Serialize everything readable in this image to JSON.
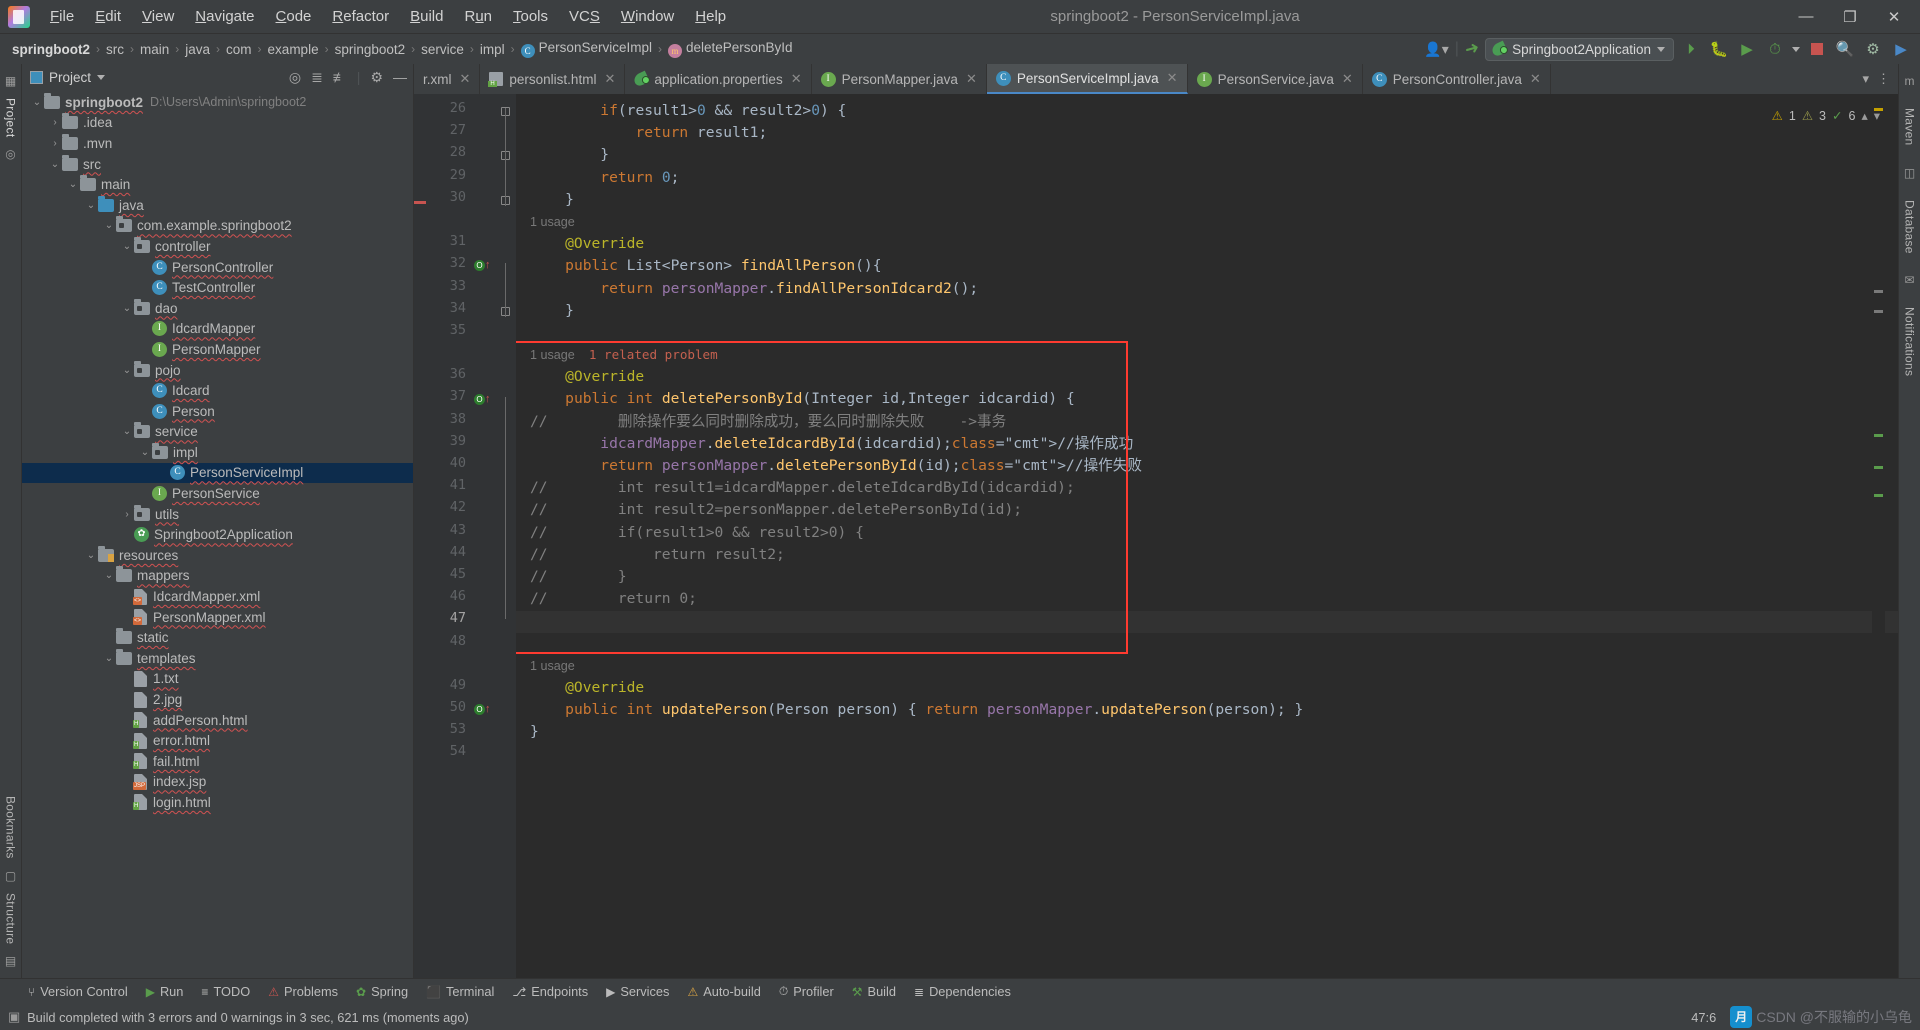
{
  "window": {
    "title": "springboot2 - PersonServiceImpl.java",
    "minimize": "—",
    "maximize": "❐",
    "close": "✕"
  },
  "menu": [
    "File",
    "Edit",
    "View",
    "Navigate",
    "Code",
    "Refactor",
    "Build",
    "Run",
    "Tools",
    "VCS",
    "Window",
    "Help"
  ],
  "breadcrumb": [
    {
      "label": "springboot2",
      "icon": ""
    },
    {
      "label": "src",
      "icon": ""
    },
    {
      "label": "main",
      "icon": ""
    },
    {
      "label": "java",
      "icon": ""
    },
    {
      "label": "com",
      "icon": ""
    },
    {
      "label": "example",
      "icon": ""
    },
    {
      "label": "springboot2",
      "icon": ""
    },
    {
      "label": "service",
      "icon": ""
    },
    {
      "label": "impl",
      "icon": ""
    },
    {
      "label": "PersonServiceImpl",
      "icon": "class-icon"
    },
    {
      "label": "deletePersonById",
      "icon": "method-icon"
    }
  ],
  "toolbar": {
    "run_config": "Springboot2Application",
    "icons": [
      "run-icon",
      "debug-icon",
      "run-with-coverage-icon",
      "profiler-icon",
      "stop-icon",
      "search-icon",
      "settings-icon",
      "ide-icon"
    ]
  },
  "project_panel": {
    "title": "Project",
    "tools": [
      "locate-icon",
      "expand-all-icon",
      "collapse-all-icon",
      "settings-icon",
      "hide-icon"
    ],
    "tree": [
      {
        "depth": 0,
        "arrow": "⌄",
        "icon": "module",
        "label": "springboot2",
        "bold": true,
        "path": "D:\\Users\\Admin\\springboot2"
      },
      {
        "depth": 1,
        "arrow": "›",
        "icon": "folder",
        "label": ".idea"
      },
      {
        "depth": 1,
        "arrow": "›",
        "icon": "folder",
        "label": ".mvn"
      },
      {
        "depth": 1,
        "arrow": "⌄",
        "icon": "folder",
        "label": "src"
      },
      {
        "depth": 2,
        "arrow": "⌄",
        "icon": "folder",
        "label": "main"
      },
      {
        "depth": 3,
        "arrow": "⌄",
        "icon": "folder-blue",
        "label": "java"
      },
      {
        "depth": 4,
        "arrow": "⌄",
        "icon": "package",
        "label": "com.example.springboot2"
      },
      {
        "depth": 5,
        "arrow": "⌄",
        "icon": "package",
        "label": "controller"
      },
      {
        "depth": 6,
        "arrow": "",
        "icon": "class",
        "label": "PersonController"
      },
      {
        "depth": 6,
        "arrow": "",
        "icon": "class",
        "label": "TestController"
      },
      {
        "depth": 5,
        "arrow": "⌄",
        "icon": "package",
        "label": "dao"
      },
      {
        "depth": 6,
        "arrow": "",
        "icon": "interface",
        "label": "IdcardMapper"
      },
      {
        "depth": 6,
        "arrow": "",
        "icon": "interface",
        "label": "PersonMapper"
      },
      {
        "depth": 5,
        "arrow": "⌄",
        "icon": "package",
        "label": "pojo"
      },
      {
        "depth": 6,
        "arrow": "",
        "icon": "class",
        "label": "Idcard"
      },
      {
        "depth": 6,
        "arrow": "",
        "icon": "class",
        "label": "Person"
      },
      {
        "depth": 5,
        "arrow": "⌄",
        "icon": "package",
        "label": "service"
      },
      {
        "depth": 6,
        "arrow": "⌄",
        "icon": "package",
        "label": "impl"
      },
      {
        "depth": 7,
        "arrow": "",
        "icon": "class",
        "label": "PersonServiceImpl",
        "selected": true
      },
      {
        "depth": 6,
        "arrow": "",
        "icon": "interface",
        "label": "PersonService"
      },
      {
        "depth": 5,
        "arrow": "›",
        "icon": "package",
        "label": "utils"
      },
      {
        "depth": 5,
        "arrow": "",
        "icon": "spring",
        "label": "Springboot2Application"
      },
      {
        "depth": 3,
        "arrow": "⌄",
        "icon": "resources",
        "label": "resources"
      },
      {
        "depth": 4,
        "arrow": "⌄",
        "icon": "folder",
        "label": "mappers"
      },
      {
        "depth": 5,
        "arrow": "",
        "icon": "xml",
        "label": "IdcardMapper.xml"
      },
      {
        "depth": 5,
        "arrow": "",
        "icon": "xml",
        "label": "PersonMapper.xml"
      },
      {
        "depth": 4,
        "arrow": "",
        "icon": "folder",
        "label": "static"
      },
      {
        "depth": 4,
        "arrow": "⌄",
        "icon": "folder",
        "label": "templates"
      },
      {
        "depth": 5,
        "arrow": "",
        "icon": "file",
        "label": "1.txt"
      },
      {
        "depth": 5,
        "arrow": "",
        "icon": "image",
        "label": "2.jpg"
      },
      {
        "depth": 5,
        "arrow": "",
        "icon": "html",
        "label": "addPerson.html"
      },
      {
        "depth": 5,
        "arrow": "",
        "icon": "html",
        "label": "error.html"
      },
      {
        "depth": 5,
        "arrow": "",
        "icon": "html",
        "label": "fail.html"
      },
      {
        "depth": 5,
        "arrow": "",
        "icon": "jsp",
        "label": "index.jsp"
      },
      {
        "depth": 5,
        "arrow": "",
        "icon": "html",
        "label": "login.html"
      }
    ]
  },
  "editor_tabs": [
    {
      "label": "r.xml",
      "icon": "xml",
      "active": false,
      "partial": true
    },
    {
      "label": "personlist.html",
      "icon": "html",
      "active": false
    },
    {
      "label": "application.properties",
      "icon": "spring",
      "active": false
    },
    {
      "label": "PersonMapper.java",
      "icon": "interface",
      "active": false
    },
    {
      "label": "PersonServiceImpl.java",
      "icon": "class",
      "active": true
    },
    {
      "label": "PersonService.java",
      "icon": "interface",
      "active": false
    },
    {
      "label": "PersonController.java",
      "icon": "class",
      "active": false
    }
  ],
  "inspection": {
    "warnings": "1",
    "weak_warnings": "3",
    "oks": "6"
  },
  "code_lines": [
    {
      "num": "26",
      "text": "        if(result1>0 && result2>0) {",
      "fold": "end-top"
    },
    {
      "num": "27",
      "text": "            return result1;"
    },
    {
      "num": "28",
      "text": "        }",
      "fold": "end"
    },
    {
      "num": "29",
      "text": "        return 0;"
    },
    {
      "num": "30",
      "text": "    }",
      "fold": "end"
    },
    {
      "num": "",
      "hint": "1 usage"
    },
    {
      "num": "31",
      "text": "    @Override"
    },
    {
      "num": "32",
      "text": "    public List<Person> findAllPerson(){",
      "gutter": "override"
    },
    {
      "num": "33",
      "text": "        return personMapper.findAllPersonIdcard2();"
    },
    {
      "num": "34",
      "text": "    }",
      "fold": "end"
    },
    {
      "num": "35",
      "text": ""
    },
    {
      "num": "",
      "hint": "1 usage",
      "hint2": "1 related problem"
    },
    {
      "num": "36",
      "text": "    @Override"
    },
    {
      "num": "37",
      "text": "    public int deletePersonById(Integer id,Integer idcardid) {",
      "gutter": "override"
    },
    {
      "num": "38",
      "text": "//        删除操作要么同时删除成功，要么同时删除失败    ->事务"
    },
    {
      "num": "39",
      "text": "        idcardMapper.deleteIdcardById(idcardid);//操作成功"
    },
    {
      "num": "40",
      "text": "        return personMapper.deletePersonById(id);//操作失败"
    },
    {
      "num": "41",
      "text": "//        int result1=idcardMapper.deleteIdcardById(idcardid);"
    },
    {
      "num": "42",
      "text": "//        int result2=personMapper.deletePersonById(id);"
    },
    {
      "num": "43",
      "text": "//        if(result1>0 && result2>0) {"
    },
    {
      "num": "44",
      "text": "//            return result2;"
    },
    {
      "num": "45",
      "text": "//        }"
    },
    {
      "num": "46",
      "text": "//        return 0;"
    },
    {
      "num": "47",
      "text": "    }",
      "current": true
    },
    {
      "num": "48",
      "text": ""
    },
    {
      "num": "",
      "hint": "1 usage"
    },
    {
      "num": "49",
      "text": "    @Override"
    },
    {
      "num": "50",
      "text": "    public int updatePerson(Person person) { return personMapper.updatePerson(person); }",
      "gutter": "override"
    },
    {
      "num": "53",
      "text": "}"
    },
    {
      "num": "54",
      "text": ""
    }
  ],
  "bottom_tabs": [
    {
      "label": "Version Control",
      "icon": "branch-icon"
    },
    {
      "label": "Run",
      "icon": "run-icon"
    },
    {
      "label": "TODO",
      "icon": "todo-icon"
    },
    {
      "label": "Problems",
      "icon": "problems-icon"
    },
    {
      "label": "Spring",
      "icon": "spring-icon"
    },
    {
      "label": "Terminal",
      "icon": "terminal-icon"
    },
    {
      "label": "Endpoints",
      "icon": "endpoints-icon"
    },
    {
      "label": "Services",
      "icon": "services-icon"
    },
    {
      "label": "Auto-build",
      "icon": "warning-icon"
    },
    {
      "label": "Profiler",
      "icon": "profiler-icon"
    },
    {
      "label": "Build",
      "icon": "build-icon"
    },
    {
      "label": "Dependencies",
      "icon": "dependencies-icon"
    }
  ],
  "status": {
    "message": "Build completed with 3 errors and 0 warnings in 3 sec, 621 ms (moments ago)",
    "caret": "47:6",
    "watermark": "CSDN @不服输的小乌龟"
  },
  "left_strip": [
    "Project",
    "Bookmarks",
    "Structure"
  ],
  "right_strip": [
    "Maven",
    "Database",
    "Notifications"
  ],
  "colors": {
    "bg": "#3c3f41",
    "editor_bg": "#2b2b2b",
    "gutter": "#313335",
    "accent": "#4a88c7",
    "keyword": "#cc7832",
    "string": "#6a8759",
    "number": "#6897bb",
    "field": "#9876aa",
    "method": "#ffc66d",
    "annotation": "#bbb529",
    "comment": "#808080",
    "highlight_box": "#ff3b30",
    "selection": "#0d2c4c"
  }
}
